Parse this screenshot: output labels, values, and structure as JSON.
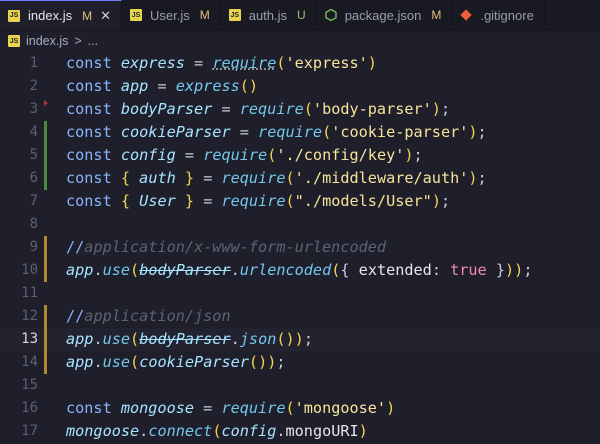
{
  "tabs": [
    {
      "label": "index.js",
      "status": "M",
      "active": true,
      "icon": "js-icon",
      "status_color": "#e6c07b"
    },
    {
      "label": "User.js",
      "status": "M",
      "active": false,
      "icon": "js-icon",
      "status_color": "#e6c07b"
    },
    {
      "label": "auth.js",
      "status": "U",
      "active": false,
      "icon": "js-icon",
      "status_color": "#98c379"
    },
    {
      "label": "package.json",
      "status": "M",
      "active": false,
      "icon": "node-icon",
      "status_color": "#e6c07b"
    },
    {
      "label": ".gitignore",
      "status": "",
      "active": false,
      "icon": "git-icon",
      "status_color": ""
    }
  ],
  "breadcrumb": {
    "file": "index.js",
    "separator": ">",
    "rest": "..."
  },
  "lines": [
    {
      "n": "1",
      "mark": "",
      "tokens": [
        [
          "kw",
          "const "
        ],
        [
          "var",
          "express"
        ],
        [
          "op",
          " = "
        ],
        [
          "fn dotted",
          "require"
        ],
        [
          "br",
          "("
        ],
        [
          "str",
          "'express'"
        ],
        [
          "br",
          ")"
        ]
      ]
    },
    {
      "n": "2",
      "mark": "",
      "tokens": [
        [
          "kw",
          "const "
        ],
        [
          "var",
          "app"
        ],
        [
          "op",
          " = "
        ],
        [
          "fn",
          "express"
        ],
        [
          "br",
          "()"
        ]
      ]
    },
    {
      "n": "3",
      "mark": "dot",
      "tokens": [
        [
          "kw",
          "const "
        ],
        [
          "var",
          "bodyParser"
        ],
        [
          "op",
          " = "
        ],
        [
          "fn",
          "require"
        ],
        [
          "br",
          "("
        ],
        [
          "str",
          "'body-parser'"
        ],
        [
          "br",
          ")"
        ],
        [
          "op",
          ";"
        ]
      ]
    },
    {
      "n": "4",
      "mark": "add",
      "tokens": [
        [
          "kw",
          "const "
        ],
        [
          "var",
          "cookieParser"
        ],
        [
          "op",
          " = "
        ],
        [
          "fn",
          "require"
        ],
        [
          "br",
          "("
        ],
        [
          "str",
          "'cookie-parser'"
        ],
        [
          "br",
          ")"
        ],
        [
          "op",
          ";"
        ]
      ]
    },
    {
      "n": "5",
      "mark": "add",
      "tokens": [
        [
          "kw",
          "const "
        ],
        [
          "var",
          "config"
        ],
        [
          "op",
          " = "
        ],
        [
          "fn",
          "require"
        ],
        [
          "br",
          "("
        ],
        [
          "str",
          "'./config/key'"
        ],
        [
          "br",
          ")"
        ],
        [
          "op",
          ";"
        ]
      ]
    },
    {
      "n": "6",
      "mark": "add",
      "tokens": [
        [
          "kw",
          "const "
        ],
        [
          "br",
          "{ "
        ],
        [
          "var",
          "auth"
        ],
        [
          "br",
          " }"
        ],
        [
          "op",
          " = "
        ],
        [
          "fn",
          "require"
        ],
        [
          "br",
          "("
        ],
        [
          "str",
          "'./middleware/auth'"
        ],
        [
          "br",
          ")"
        ],
        [
          "op",
          ";"
        ]
      ]
    },
    {
      "n": "7",
      "mark": "",
      "tokens": [
        [
          "kw",
          "const "
        ],
        [
          "br",
          "{ "
        ],
        [
          "var",
          "User"
        ],
        [
          "br",
          " }"
        ],
        [
          "op",
          " = "
        ],
        [
          "fn",
          "require"
        ],
        [
          "br",
          "("
        ],
        [
          "str",
          "\"./models/User\""
        ],
        [
          "br",
          ")"
        ],
        [
          "op",
          ";"
        ]
      ]
    },
    {
      "n": "8",
      "mark": "",
      "tokens": []
    },
    {
      "n": "9",
      "mark": "mod",
      "tokens": [
        [
          "cm-slash",
          "//"
        ],
        [
          "cm",
          "application/x-www-form-urlencoded"
        ]
      ]
    },
    {
      "n": "10",
      "mark": "mod",
      "tokens": [
        [
          "var",
          "app"
        ],
        [
          "op",
          "."
        ],
        [
          "fn",
          "use"
        ],
        [
          "br",
          "("
        ],
        [
          "var strike",
          "bodyParser"
        ],
        [
          "op",
          "."
        ],
        [
          "fn",
          "urlencoded"
        ],
        [
          "br",
          "("
        ],
        [
          "op",
          "{ "
        ],
        [
          "prop",
          "extended"
        ],
        [
          "op",
          ": "
        ],
        [
          "bool",
          "true"
        ],
        [
          "op",
          " }"
        ],
        [
          "br",
          ")"
        ],
        [
          "br",
          ")"
        ],
        [
          "op",
          ";"
        ]
      ]
    },
    {
      "n": "11",
      "mark": "",
      "tokens": []
    },
    {
      "n": "12",
      "mark": "mod",
      "tokens": [
        [
          "cm-slash",
          "//"
        ],
        [
          "cm",
          "application/json"
        ]
      ]
    },
    {
      "n": "13",
      "mark": "mod",
      "current": true,
      "tokens": [
        [
          "var",
          "app"
        ],
        [
          "op",
          "."
        ],
        [
          "fn",
          "use"
        ],
        [
          "br",
          "("
        ],
        [
          "var strike",
          "bodyParser"
        ],
        [
          "op",
          "."
        ],
        [
          "fn",
          "json"
        ],
        [
          "br",
          "()"
        ],
        [
          "br",
          ")"
        ],
        [
          "op",
          ";"
        ]
      ]
    },
    {
      "n": "14",
      "mark": "mod",
      "tokens": [
        [
          "var",
          "app"
        ],
        [
          "op",
          "."
        ],
        [
          "fn",
          "use"
        ],
        [
          "br",
          "("
        ],
        [
          "var",
          "cookieParser"
        ],
        [
          "br",
          "()"
        ],
        [
          "br",
          ")"
        ],
        [
          "op",
          ";"
        ]
      ]
    },
    {
      "n": "15",
      "mark": "",
      "tokens": []
    },
    {
      "n": "16",
      "mark": "",
      "tokens": [
        [
          "kw",
          "const "
        ],
        [
          "var",
          "mongoose"
        ],
        [
          "op",
          " = "
        ],
        [
          "fn",
          "require"
        ],
        [
          "br",
          "("
        ],
        [
          "str",
          "'mongoose'"
        ],
        [
          "br",
          ")"
        ]
      ]
    },
    {
      "n": "17",
      "mark": "",
      "tokens": [
        [
          "var",
          "mongoose"
        ],
        [
          "op",
          "."
        ],
        [
          "fn",
          "connect"
        ],
        [
          "br",
          "("
        ],
        [
          "var",
          "config"
        ],
        [
          "op",
          "."
        ],
        [
          "prop",
          "mongoURI"
        ],
        [
          "br",
          ")"
        ]
      ]
    }
  ]
}
